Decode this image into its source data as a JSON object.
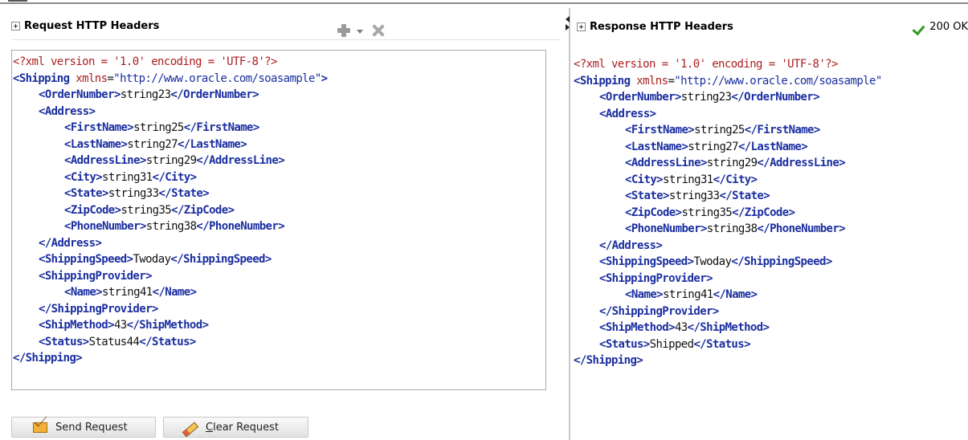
{
  "request": {
    "header_title": "Request HTTP Headers",
    "lines": [
      {
        "indent": 0,
        "parts": [
          {
            "k": "prolog",
            "t": "<?xml version = '1.0' encoding = 'UTF-8'?>"
          }
        ]
      },
      {
        "indent": 0,
        "parts": [
          {
            "k": "tag",
            "t": "<Shipping"
          },
          {
            "k": "attr",
            "t": " xmlns"
          },
          {
            "k": "text",
            "t": "="
          },
          {
            "k": "val",
            "t": "\"http://www.oracle.com/soasample\""
          },
          {
            "k": "tag",
            "t": ">"
          }
        ]
      },
      {
        "indent": 1,
        "parts": [
          {
            "k": "tag",
            "t": "<OrderNumber>"
          },
          {
            "k": "text",
            "t": "string23"
          },
          {
            "k": "tag",
            "t": "</OrderNumber>"
          }
        ]
      },
      {
        "indent": 1,
        "parts": [
          {
            "k": "tag",
            "t": "<Address>"
          }
        ]
      },
      {
        "indent": 2,
        "parts": [
          {
            "k": "tag",
            "t": "<FirstName>"
          },
          {
            "k": "text",
            "t": "string25"
          },
          {
            "k": "tag",
            "t": "</FirstName>"
          }
        ]
      },
      {
        "indent": 2,
        "parts": [
          {
            "k": "tag",
            "t": "<LastName>"
          },
          {
            "k": "text",
            "t": "string27"
          },
          {
            "k": "tag",
            "t": "</LastName>"
          }
        ]
      },
      {
        "indent": 2,
        "parts": [
          {
            "k": "tag",
            "t": "<AddressLine>"
          },
          {
            "k": "text",
            "t": "string29"
          },
          {
            "k": "tag",
            "t": "</AddressLine>"
          }
        ]
      },
      {
        "indent": 2,
        "parts": [
          {
            "k": "tag",
            "t": "<City>"
          },
          {
            "k": "text",
            "t": "string31"
          },
          {
            "k": "tag",
            "t": "</City>"
          }
        ]
      },
      {
        "indent": 2,
        "parts": [
          {
            "k": "tag",
            "t": "<State>"
          },
          {
            "k": "text",
            "t": "string33"
          },
          {
            "k": "tag",
            "t": "</State>"
          }
        ]
      },
      {
        "indent": 2,
        "parts": [
          {
            "k": "tag",
            "t": "<ZipCode>"
          },
          {
            "k": "text",
            "t": "string35"
          },
          {
            "k": "tag",
            "t": "</ZipCode>"
          }
        ]
      },
      {
        "indent": 2,
        "parts": [
          {
            "k": "tag",
            "t": "<PhoneNumber>"
          },
          {
            "k": "text",
            "t": "string38"
          },
          {
            "k": "tag",
            "t": "</PhoneNumber>"
          }
        ]
      },
      {
        "indent": 1,
        "parts": [
          {
            "k": "tag",
            "t": "</Address>"
          }
        ]
      },
      {
        "indent": 1,
        "parts": [
          {
            "k": "tag",
            "t": "<ShippingSpeed>"
          },
          {
            "k": "text",
            "t": "Twoday"
          },
          {
            "k": "tag",
            "t": "</ShippingSpeed>"
          }
        ]
      },
      {
        "indent": 1,
        "parts": [
          {
            "k": "tag",
            "t": "<ShippingProvider>"
          }
        ]
      },
      {
        "indent": 2,
        "parts": [
          {
            "k": "tag",
            "t": "<Name>"
          },
          {
            "k": "text",
            "t": "string41"
          },
          {
            "k": "tag",
            "t": "</Name>"
          }
        ]
      },
      {
        "indent": 1,
        "parts": [
          {
            "k": "tag",
            "t": "</ShippingProvider>"
          }
        ]
      },
      {
        "indent": 1,
        "parts": [
          {
            "k": "tag",
            "t": "<ShipMethod>"
          },
          {
            "k": "text",
            "t": "43"
          },
          {
            "k": "tag",
            "t": "</ShipMethod>"
          }
        ]
      },
      {
        "indent": 1,
        "parts": [
          {
            "k": "tag",
            "t": "<Status>"
          },
          {
            "k": "text",
            "t": "Status44"
          },
          {
            "k": "tag",
            "t": "</Status>"
          }
        ]
      },
      {
        "indent": 0,
        "parts": [
          {
            "k": "tag",
            "t": "</Shipping>"
          }
        ]
      }
    ]
  },
  "response": {
    "header_title": "Response HTTP Headers",
    "status_text": "200 OK",
    "lines": [
      {
        "indent": 0,
        "parts": [
          {
            "k": "prolog",
            "t": "<?xml version = '1.0' encoding = 'UTF-8'?>"
          }
        ]
      },
      {
        "indent": 0,
        "parts": [
          {
            "k": "tag",
            "t": "<Shipping"
          },
          {
            "k": "attr",
            "t": " xmlns"
          },
          {
            "k": "text",
            "t": "="
          },
          {
            "k": "val",
            "t": "\"http://www.oracle.com/soasample\""
          }
        ]
      },
      {
        "indent": 1,
        "parts": [
          {
            "k": "tag",
            "t": "<OrderNumber>"
          },
          {
            "k": "text",
            "t": "string23"
          },
          {
            "k": "tag",
            "t": "</OrderNumber>"
          }
        ]
      },
      {
        "indent": 1,
        "parts": [
          {
            "k": "tag",
            "t": "<Address>"
          }
        ]
      },
      {
        "indent": 2,
        "parts": [
          {
            "k": "tag",
            "t": "<FirstName>"
          },
          {
            "k": "text",
            "t": "string25"
          },
          {
            "k": "tag",
            "t": "</FirstName>"
          }
        ]
      },
      {
        "indent": 2,
        "parts": [
          {
            "k": "tag",
            "t": "<LastName>"
          },
          {
            "k": "text",
            "t": "string27"
          },
          {
            "k": "tag",
            "t": "</LastName>"
          }
        ]
      },
      {
        "indent": 2,
        "parts": [
          {
            "k": "tag",
            "t": "<AddressLine>"
          },
          {
            "k": "text",
            "t": "string29"
          },
          {
            "k": "tag",
            "t": "</AddressLine>"
          }
        ]
      },
      {
        "indent": 2,
        "parts": [
          {
            "k": "tag",
            "t": "<City>"
          },
          {
            "k": "text",
            "t": "string31"
          },
          {
            "k": "tag",
            "t": "</City>"
          }
        ]
      },
      {
        "indent": 2,
        "parts": [
          {
            "k": "tag",
            "t": "<State>"
          },
          {
            "k": "text",
            "t": "string33"
          },
          {
            "k": "tag",
            "t": "</State>"
          }
        ]
      },
      {
        "indent": 2,
        "parts": [
          {
            "k": "tag",
            "t": "<ZipCode>"
          },
          {
            "k": "text",
            "t": "string35"
          },
          {
            "k": "tag",
            "t": "</ZipCode>"
          }
        ]
      },
      {
        "indent": 2,
        "parts": [
          {
            "k": "tag",
            "t": "<PhoneNumber>"
          },
          {
            "k": "text",
            "t": "string38"
          },
          {
            "k": "tag",
            "t": "</PhoneNumber>"
          }
        ]
      },
      {
        "indent": 1,
        "parts": [
          {
            "k": "tag",
            "t": "</Address>"
          }
        ]
      },
      {
        "indent": 1,
        "parts": [
          {
            "k": "tag",
            "t": "<ShippingSpeed>"
          },
          {
            "k": "text",
            "t": "Twoday"
          },
          {
            "k": "tag",
            "t": "</ShippingSpeed>"
          }
        ]
      },
      {
        "indent": 1,
        "parts": [
          {
            "k": "tag",
            "t": "<ShippingProvider>"
          }
        ]
      },
      {
        "indent": 2,
        "parts": [
          {
            "k": "tag",
            "t": "<Name>"
          },
          {
            "k": "text",
            "t": "string41"
          },
          {
            "k": "tag",
            "t": "</Name>"
          }
        ]
      },
      {
        "indent": 1,
        "parts": [
          {
            "k": "tag",
            "t": "</ShippingProvider>"
          }
        ]
      },
      {
        "indent": 1,
        "parts": [
          {
            "k": "tag",
            "t": "<ShipMethod>"
          },
          {
            "k": "text",
            "t": "43"
          },
          {
            "k": "tag",
            "t": "</ShipMethod>"
          }
        ]
      },
      {
        "indent": 1,
        "parts": [
          {
            "k": "tag",
            "t": "<Status>"
          },
          {
            "k": "text",
            "t": "Shipped"
          },
          {
            "k": "tag",
            "t": "</Status>"
          }
        ]
      },
      {
        "indent": 0,
        "parts": [
          {
            "k": "tag",
            "t": "</Shipping>"
          }
        ]
      }
    ]
  },
  "buttons": {
    "send_label": "Send Request",
    "clear_label": "Clear Request"
  },
  "icons": {
    "add": "plus-icon",
    "dropdown": "chevron-down-icon",
    "remove": "close-icon",
    "status": "check-icon",
    "send": "envelope-icon",
    "clear": "eraser-icon"
  },
  "colors": {
    "tag": "#1b2fa0",
    "attribute": "#aa2020",
    "status_ok": "#2e9a1e"
  }
}
